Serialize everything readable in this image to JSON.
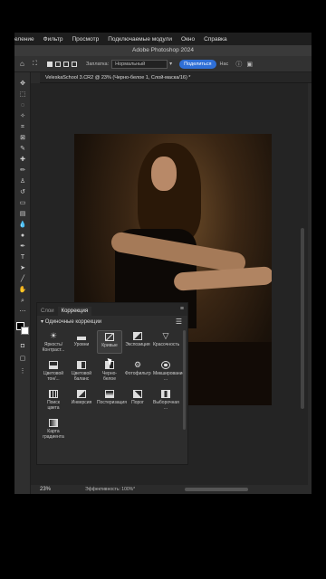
{
  "menu": [
    "еление",
    "Фильтр",
    "Просмотр",
    "Подключаемые модули",
    "Окно",
    "Справка"
  ],
  "app_title": "Adobe Photoshop 2024",
  "options": {
    "fill_label": "Заплатка:",
    "mode_value": "Нормальный",
    "share_button": "Поделиться",
    "extra_label": "Нас"
  },
  "document_tab": "VeleskaSchool 3.CR2 @ 23% (Черно-белое 1, Слой-маска/16) *",
  "panel": {
    "tabs": [
      "Слои",
      "Коррекция"
    ],
    "active_tab": "Коррекция",
    "section_title": "Одиночные коррекции",
    "items": [
      {
        "label": "Яркость/ Контраст...",
        "icon": "sun-icon"
      },
      {
        "label": "Уровни",
        "icon": "levels-icon"
      },
      {
        "label": "Кривые",
        "icon": "curves-icon"
      },
      {
        "label": "Экспозиция",
        "icon": "exposure-icon"
      },
      {
        "label": "Красочность",
        "icon": "vibrance-icon"
      },
      {
        "label": "Цветовой тон/...",
        "icon": "hue-icon"
      },
      {
        "label": "Цветовой баланс",
        "icon": "balance-icon"
      },
      {
        "label": "Черно-белое",
        "icon": "bw-icon"
      },
      {
        "label": "Фотофильтр",
        "icon": "photo-filter-icon"
      },
      {
        "label": "Микширование ...",
        "icon": "mixer-icon"
      },
      {
        "label": "Поиск цвета",
        "icon": "lookup-icon"
      },
      {
        "label": "Инверсия",
        "icon": "invert-icon"
      },
      {
        "label": "Постеризация",
        "icon": "posterize-icon"
      },
      {
        "label": "Порог",
        "icon": "threshold-icon"
      },
      {
        "label": "Выборочная ...",
        "icon": "selective-icon"
      },
      {
        "label": "Карта градиента",
        "icon": "gradient-map-icon"
      }
    ]
  },
  "status": {
    "zoom": "23%",
    "efficiency": "Эффективность: 100%*"
  }
}
